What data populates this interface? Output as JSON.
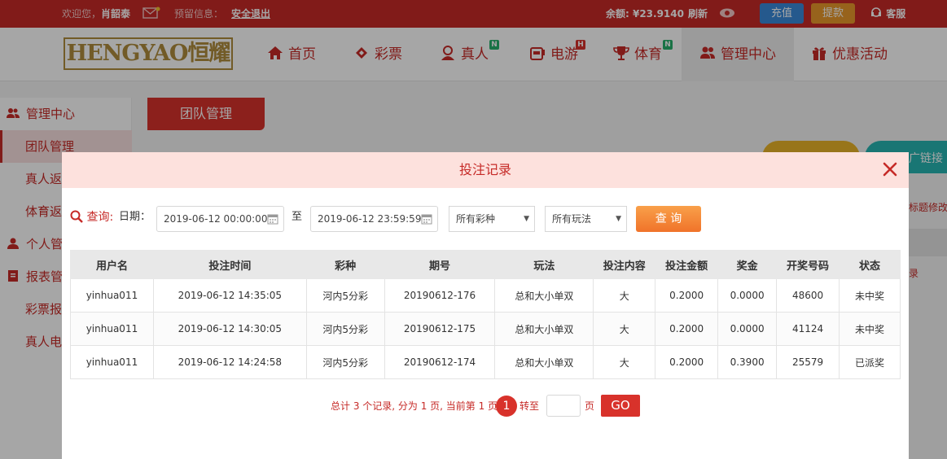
{
  "topbar": {
    "welcome": "欢迎您，",
    "username": "肖韶泰",
    "warning_label": "预留信息：",
    "logout": "安全退出",
    "balance_label": "余额: ¥",
    "balance_value": "23.9140",
    "refresh": "刷新",
    "recharge": "充值",
    "withdraw": "提款",
    "service": "客服"
  },
  "nav": {
    "logo": "HENGYAO恒耀",
    "items": [
      {
        "label": "首页"
      },
      {
        "label": "彩票"
      },
      {
        "label": "真人",
        "badge": "N"
      },
      {
        "label": "电游",
        "badge": "H"
      },
      {
        "label": "体育",
        "badge": "N"
      },
      {
        "label": "管理中心"
      },
      {
        "label": "优惠活动"
      }
    ]
  },
  "sidebar": {
    "items": [
      {
        "label": "管理中心"
      },
      {
        "label": "团队管理"
      },
      {
        "label": "真人返"
      },
      {
        "label": "体育返"
      },
      {
        "label": "个人管"
      },
      {
        "label": "报表管"
      },
      {
        "label": "彩票报"
      },
      {
        "label": "真人电"
      }
    ]
  },
  "page": {
    "tab": "团队管理",
    "promo_link": "广链接",
    "edit_text": "标题修改",
    "record_text": "录"
  },
  "modal": {
    "title": "投注记录",
    "query_label": "查询:",
    "date_label": "日期：",
    "date_from": "2019-06-12 00:00:00",
    "to_label": "至",
    "date_to": "2019-06-12 23:59:59",
    "lottery_select": "所有彩种",
    "play_select": "所有玩法",
    "query_button": "查 询"
  },
  "table": {
    "headers": [
      "用户名",
      "投注时间",
      "彩种",
      "期号",
      "玩法",
      "投注内容",
      "投注金额",
      "奖金",
      "开奖号码",
      "状态"
    ],
    "rows": [
      [
        "yinhua011",
        "2019-06-12 14:35:05",
        "河内5分彩",
        "20190612-176",
        "总和大小单双",
        "大",
        "0.2000",
        "0.0000",
        "48600",
        "未中奖"
      ],
      [
        "yinhua011",
        "2019-06-12 14:30:05",
        "河内5分彩",
        "20190612-175",
        "总和大小单双",
        "大",
        "0.2000",
        "0.0000",
        "41124",
        "未中奖"
      ],
      [
        "yinhua011",
        "2019-06-12 14:24:58",
        "河内5分彩",
        "20190612-174",
        "总和大小单双",
        "大",
        "0.2000",
        "0.3900",
        "25579",
        "已派奖"
      ]
    ]
  },
  "pager": {
    "summary": "总计 3 个记录, 分为 1 页, 当前第 1 页",
    "current": "1",
    "goto_label": "转至",
    "page_unit": "页",
    "go_button": "GO"
  },
  "colors": {
    "brand_red": "#c62a27",
    "query_orange": "#f0732a",
    "recharge_blue": "#3a89d9",
    "withdraw_orange": "#e8992b"
  }
}
